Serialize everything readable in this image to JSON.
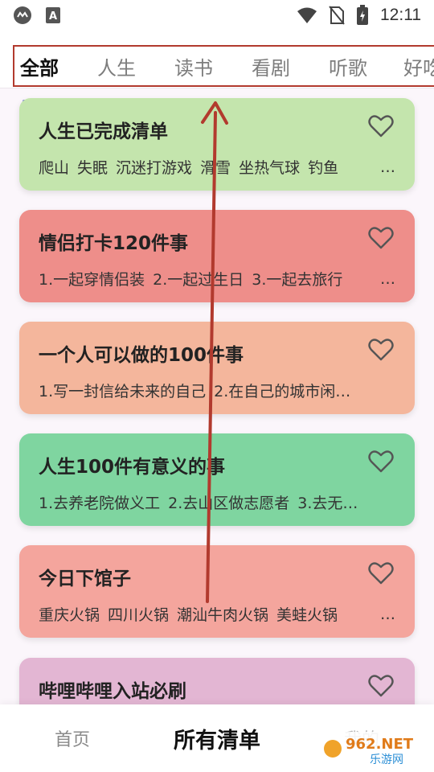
{
  "status_bar": {
    "time": "12:11",
    "icons": [
      "app-logo-icon",
      "a-notification-icon",
      "wifi-icon",
      "no-sim-icon",
      "battery-charging-icon"
    ]
  },
  "tabs": [
    {
      "label": "全部",
      "active": true
    },
    {
      "label": "人生",
      "active": false
    },
    {
      "label": "读书",
      "active": false
    },
    {
      "label": "看剧",
      "active": false
    },
    {
      "label": "听歌",
      "active": false
    },
    {
      "label": "好吃",
      "active": false
    }
  ],
  "cards": [
    {
      "title": "人生已完成清单",
      "items": [
        "爬山",
        "失眠",
        "沉迷打游戏",
        "滑雪",
        "坐热气球",
        "钓鱼"
      ],
      "more": "…",
      "color": "#c4e5ad"
    },
    {
      "title": "情侣打卡120件事",
      "items": [
        "1.一起穿情侣装",
        "2.一起过生日",
        "3.一起去旅行"
      ],
      "more": "…",
      "color": "#ee8e8a"
    },
    {
      "title": "一个人可以做的100件事",
      "items": [
        "1.写一封信给未来的自己",
        "2.在自己的城市闲…"
      ],
      "more": "",
      "color": "#f4b69c"
    },
    {
      "title": "人生100件有意义的事",
      "items": [
        "1.去养老院做义工",
        "2.去山区做志愿者",
        "3.去无…"
      ],
      "more": "",
      "color": "#7fd5a0"
    },
    {
      "title": "今日下馆子",
      "items": [
        "重庆火锅",
        "四川火锅",
        "潮汕牛肉火锅",
        "美蛙火锅"
      ],
      "more": "…",
      "color": "#f4a59d"
    },
    {
      "title": "哔哩哔哩入站必刷",
      "items": [],
      "more": "",
      "color": "#e3b6d3"
    }
  ],
  "bottom_nav": {
    "home": "首页",
    "all_lists": "所有清单",
    "mine": "我的"
  },
  "watermark": {
    "brand": "962.NET",
    "subtitle": "乐游网"
  },
  "colors": {
    "annotation_red": "#b23a2e",
    "tab_indicator": "#7b82d6"
  }
}
